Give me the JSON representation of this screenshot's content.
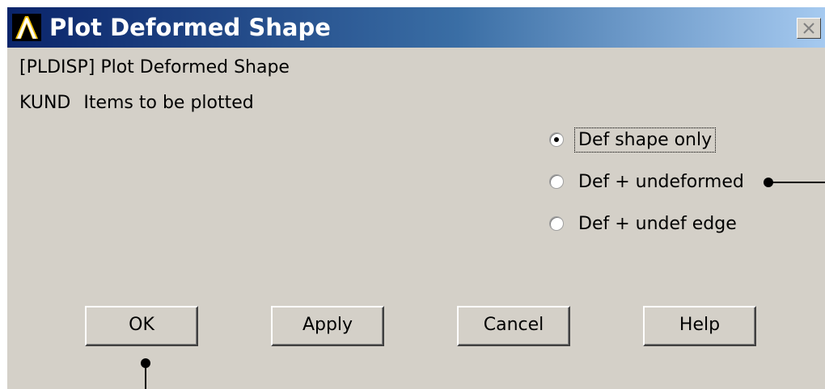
{
  "window": {
    "title": "Plot Deformed Shape"
  },
  "command": {
    "label": "[PLDISP]  Plot Deformed Shape"
  },
  "kund": {
    "key": "KUND",
    "label": "Items to be plotted"
  },
  "options": [
    {
      "label": "Def shape only",
      "selected": true
    },
    {
      "label": "Def + undeformed",
      "selected": false
    },
    {
      "label": "Def + undef edge",
      "selected": false
    }
  ],
  "buttons": {
    "ok": "OK",
    "apply": "Apply",
    "cancel": "Cancel",
    "help": "Help"
  },
  "icons": {
    "logo": "ansys-logo-icon",
    "close": "close-icon",
    "radio": "radio-button-icon"
  },
  "colors": {
    "title_start": "#0a246a",
    "title_end": "#a6caf0",
    "dialog_bg": "#d4d0c8"
  }
}
